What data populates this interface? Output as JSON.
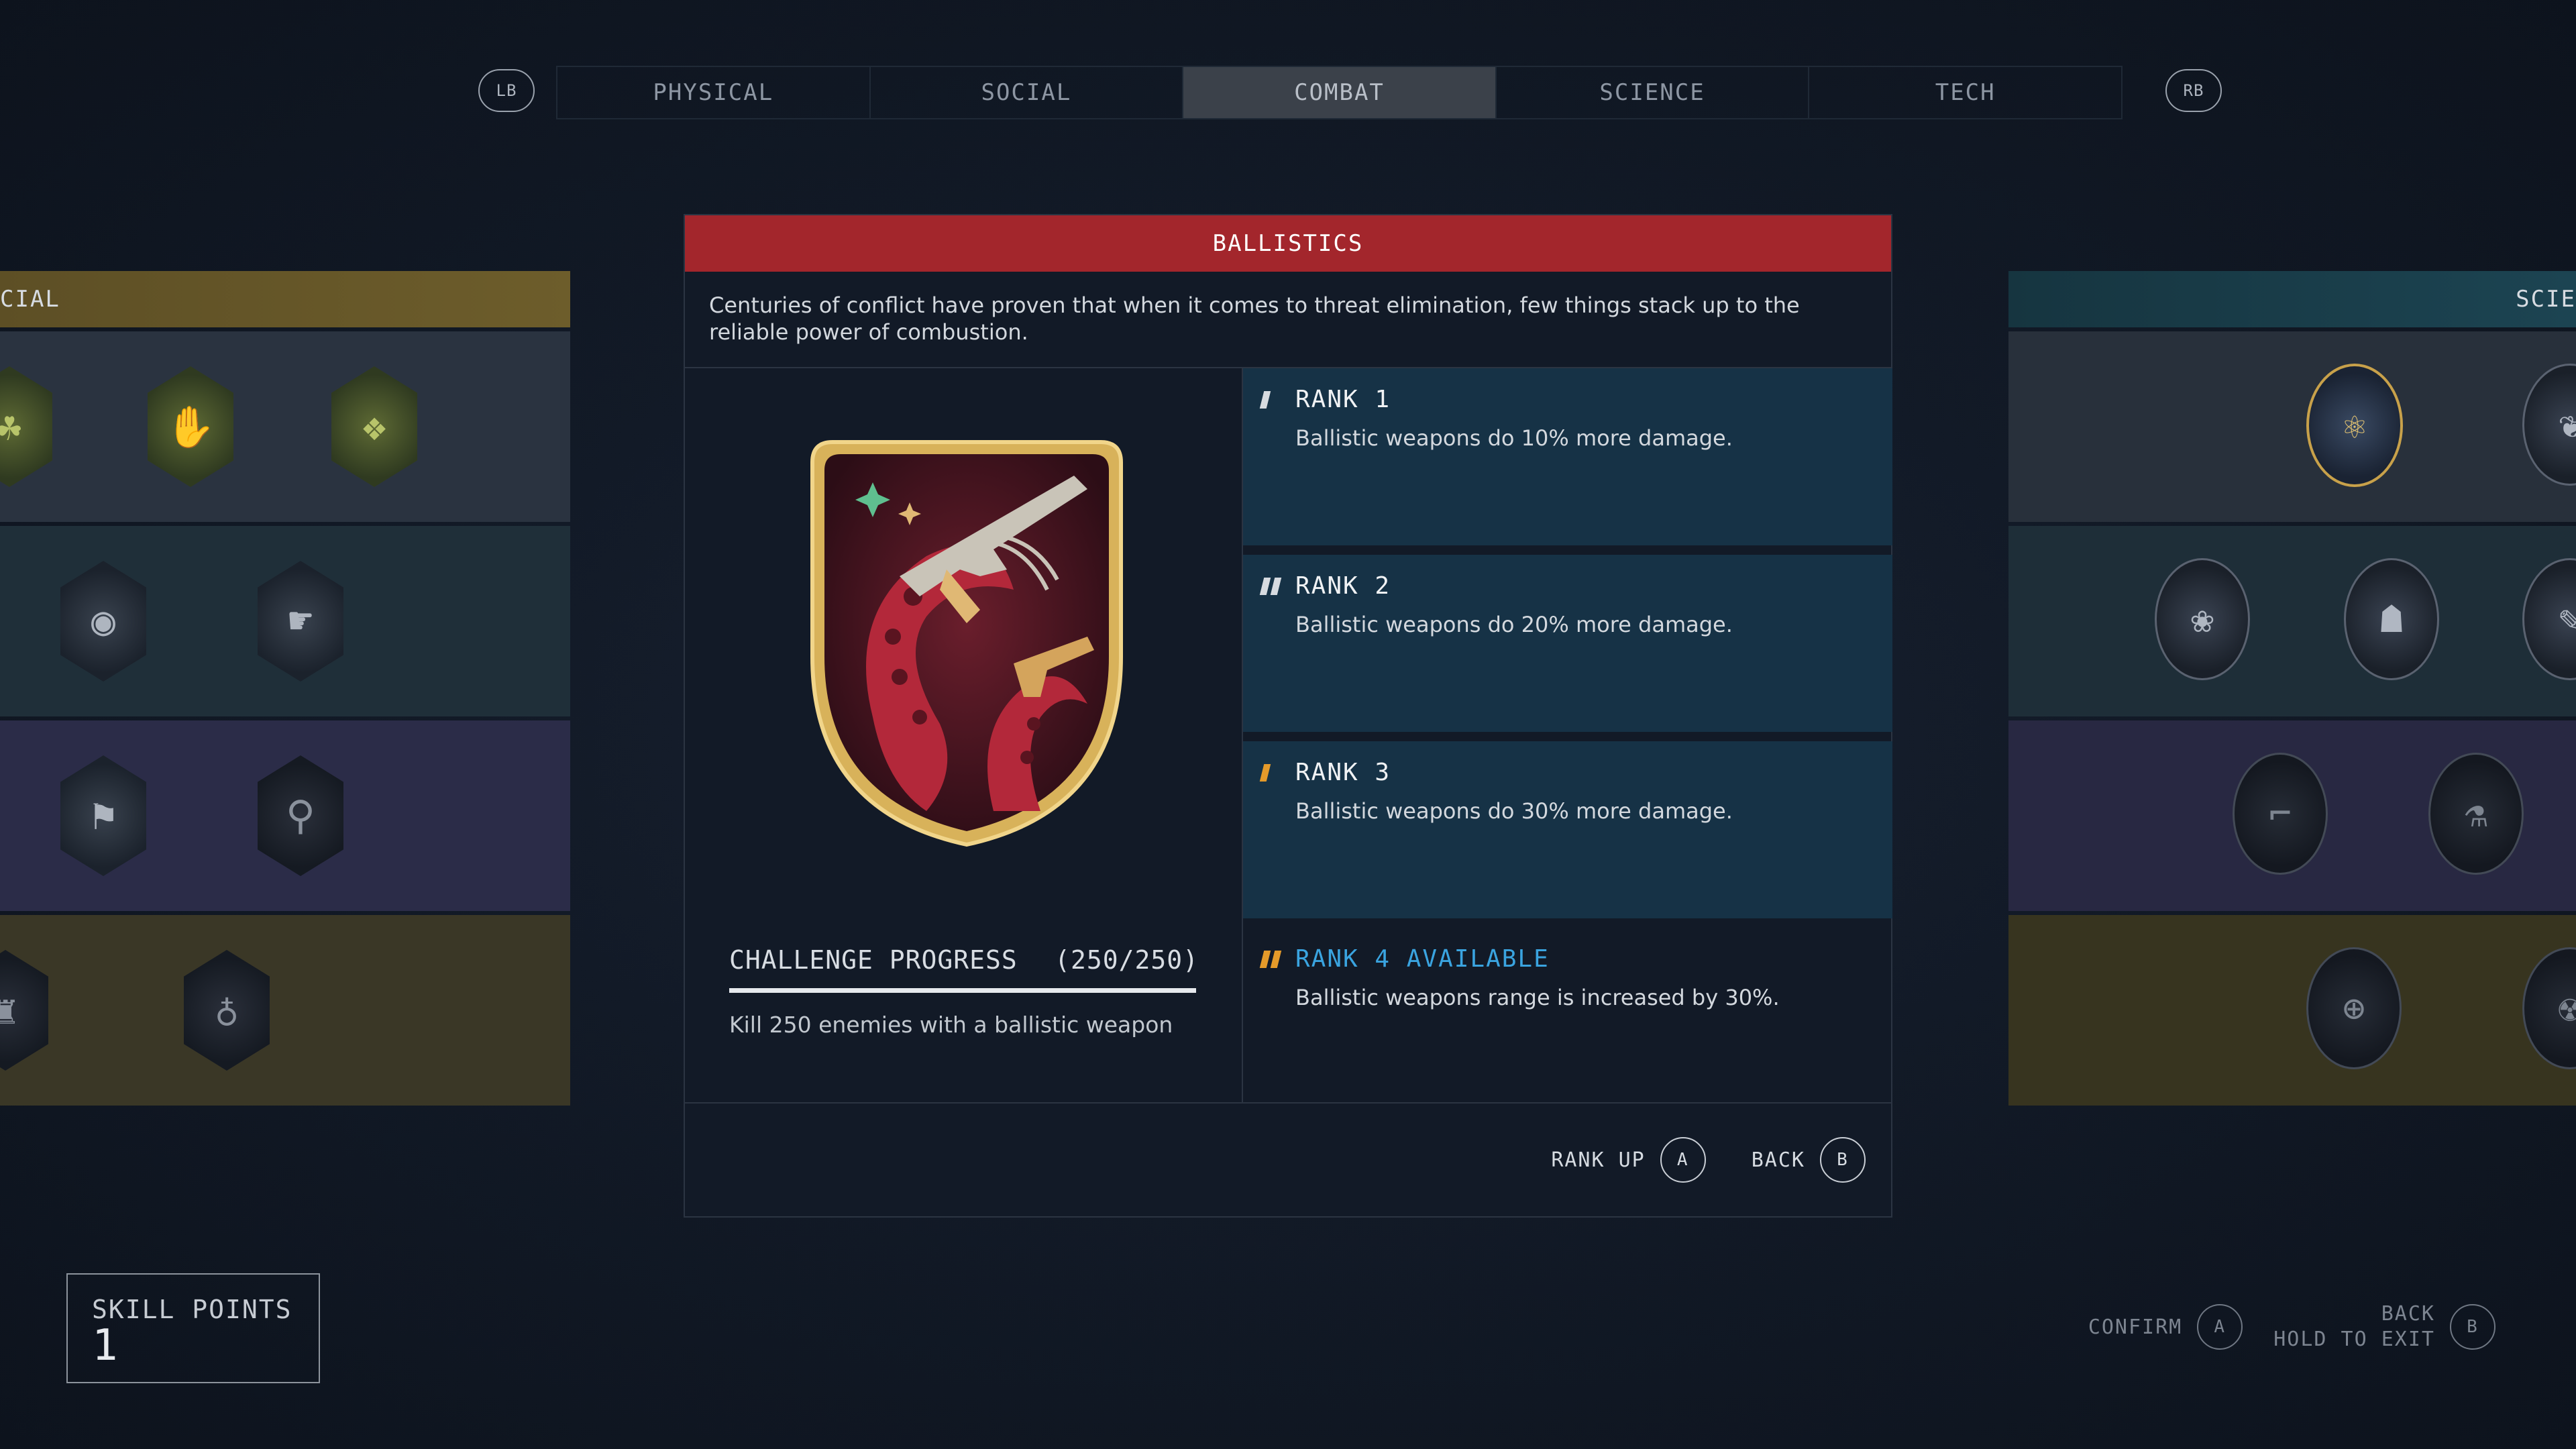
{
  "tabs": {
    "lb": "LB",
    "rb": "RB",
    "items": [
      {
        "label": "PHYSICAL"
      },
      {
        "label": "SOCIAL"
      },
      {
        "label": "COMBAT",
        "active": true
      },
      {
        "label": "SCIENCE"
      },
      {
        "label": "TECH"
      }
    ]
  },
  "left_panel": {
    "header": "CIAL"
  },
  "right_panel": {
    "header": "SCIE"
  },
  "modal": {
    "title": "BALLISTICS",
    "description": "Centuries of conflict have proven that when it comes to threat elimination, few things stack up to the reliable power of combustion.",
    "challenge": {
      "label": "CHALLENGE PROGRESS",
      "count": "(250/250)",
      "description": "Kill 250 enemies with a ballistic weapon",
      "progress": 1.0
    },
    "ranks": [
      {
        "title": "RANK 1",
        "desc": "Ballistic weapons do 10% more damage.",
        "state": "owned"
      },
      {
        "title": "RANK 2",
        "desc": "Ballistic weapons do 20% more damage.",
        "state": "owned"
      },
      {
        "title": "RANK 3",
        "desc": "Ballistic weapons do 30% more damage.",
        "state": "owned"
      },
      {
        "title": "RANK 4 AVAILABLE",
        "desc": "Ballistic weapons range is increased by 30%.",
        "state": "available"
      }
    ],
    "footer": {
      "rank_up_label": "RANK UP",
      "rank_up_key": "A",
      "back_label": "BACK",
      "back_key": "B"
    }
  },
  "skill_points": {
    "label": "SKILL POINTS",
    "value": "1"
  },
  "hints": {
    "confirm_label": "CONFIRM",
    "confirm_key": "A",
    "back_label": "BACK",
    "hold_label": "HOLD TO EXIT",
    "back_key": "B"
  },
  "colors": {
    "title_bar": "#a3262c",
    "rank_owned_bg": "#163246",
    "rank_available": "#3aa4e0",
    "rank_mark_owned": "#d7dbe0",
    "rank_mark_highlight": "#e49a2a"
  }
}
